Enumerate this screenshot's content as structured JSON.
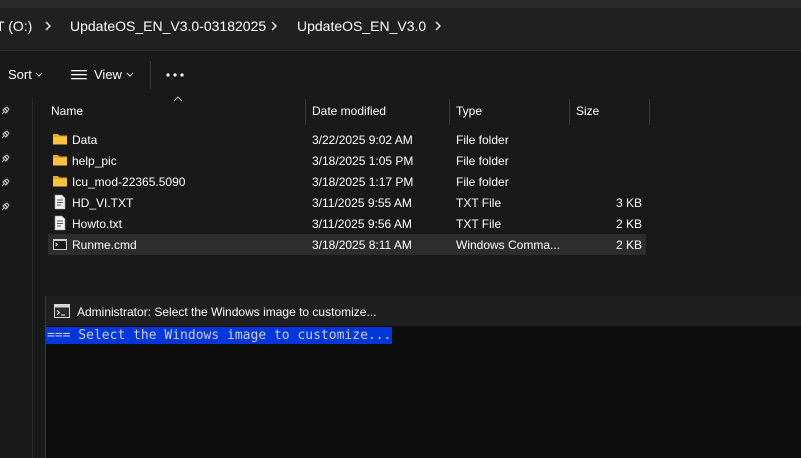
{
  "breadcrumb": [
    "T (O:)",
    "UpdateOS_EN_V3.0-03182025",
    "UpdateOS_EN_V3.0"
  ],
  "toolbar": {
    "sort_label": "Sort",
    "view_label": "View",
    "more_label": "..."
  },
  "columns": {
    "name": "Name",
    "date": "Date modified",
    "type": "Type",
    "size": "Size"
  },
  "files": [
    {
      "icon": "folder-icon",
      "name": "Data",
      "date": "3/22/2025 9:02 AM",
      "type": "File folder",
      "size": ""
    },
    {
      "icon": "folder-icon",
      "name": "help_pic",
      "date": "3/18/2025 1:05 PM",
      "type": "File folder",
      "size": ""
    },
    {
      "icon": "folder-icon",
      "name": "Icu_mod-22365.5090",
      "date": "3/18/2025 1:17 PM",
      "type": "File folder",
      "size": ""
    },
    {
      "icon": "text-file-icon",
      "name": "HD_VI.TXT",
      "date": "3/11/2025 9:55 AM",
      "type": "TXT File",
      "size": "3 KB"
    },
    {
      "icon": "text-file-icon",
      "name": "Howto.txt",
      "date": "3/11/2025 9:56 AM",
      "type": "TXT File",
      "size": "2 KB"
    },
    {
      "icon": "cmd-file-icon",
      "name": "Runme.cmd",
      "date": "3/18/2025 8:11 AM",
      "type": "Windows Comma...",
      "size": "2 KB"
    }
  ],
  "terminal": {
    "title": "Administrator:  Select the Windows image to customize...",
    "line": "=== Select the Windows image to customize..."
  },
  "colors": {
    "highlight": "#0037da",
    "folder": "#f8c440",
    "background": "#191919"
  }
}
